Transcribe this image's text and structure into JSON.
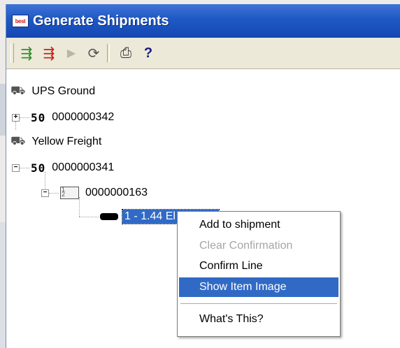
{
  "window": {
    "title": "Generate Shipments",
    "logo_text": "best"
  },
  "toolbar": {
    "buttons": [
      {
        "icon": "generate-shipment-icon",
        "glyph": "⇶",
        "color": "#2e8b2e"
      },
      {
        "icon": "remove-shipment-icon",
        "glyph": "⇶",
        "color": "#c0221a"
      },
      {
        "icon": "play-icon",
        "glyph": "▶",
        "color": "#b9b6a8"
      },
      {
        "icon": "refresh-icon",
        "glyph": "⟳",
        "color": "#555555"
      },
      {
        "icon": "print-icon",
        "glyph": "⎙",
        "color": "#333333"
      },
      {
        "icon": "help-icon",
        "glyph": "?",
        "color": "#1a1a80"
      }
    ]
  },
  "tree": {
    "carrier1": "UPS Ground",
    "order1": "0000000342",
    "carrier2": "Yellow Freight",
    "order2": "0000000341",
    "shipment": "0000000163",
    "line": "1 - 1.44 El",
    "so_glyph": "50",
    "truck_glyph": "⛟",
    "doc_glyph": "1\n2",
    "expand_glyph": "+",
    "collapse_glyph": "−"
  },
  "context_menu": {
    "items": [
      {
        "label": "Add to shipment",
        "state": "normal"
      },
      {
        "label": "Clear Confirmation",
        "state": "disabled"
      },
      {
        "label": "Confirm Line",
        "state": "normal"
      },
      {
        "label": "Show Item Image",
        "state": "hover"
      },
      {
        "label": "What's This?",
        "state": "normal"
      }
    ]
  },
  "colors": {
    "title_bar": "#1f58c4",
    "selection": "#316ac5",
    "toolbar_bg": "#ece9d8"
  }
}
